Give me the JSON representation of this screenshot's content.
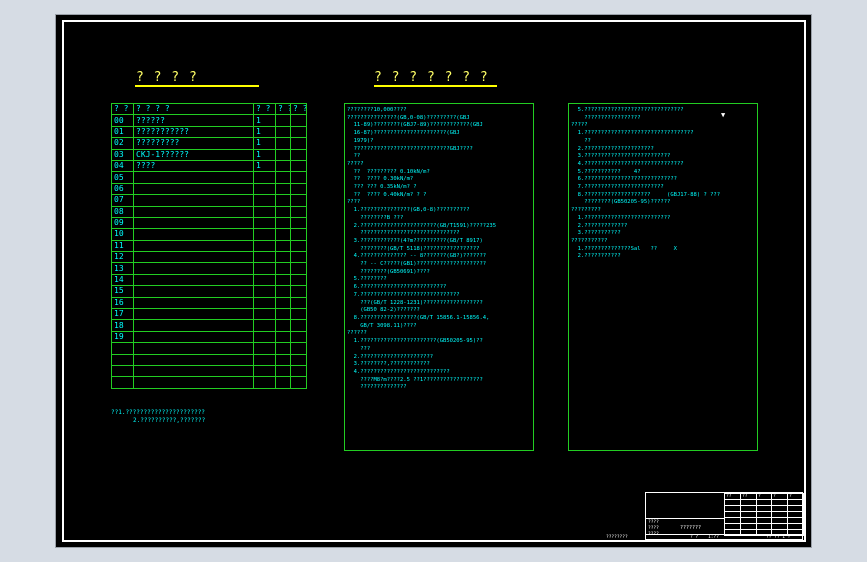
{
  "colors": {
    "background": "#000000",
    "border": "#ffffff",
    "table_lines": "#22cc22",
    "text": "#00ffff",
    "title": "#ffff66"
  },
  "left_title": "? ? ? ?",
  "mid_title": "? ? ? ? ? ? ?",
  "parts_table": {
    "headers": [
      "? ?",
      "? ? ? ?",
      "? ?",
      "? ?",
      "? ?"
    ],
    "rows": [
      {
        "no": "00",
        "name": "??????",
        "qty": "1"
      },
      {
        "no": "01",
        "name": "???????????",
        "qty": "1"
      },
      {
        "no": "02",
        "name": "?????????",
        "qty": "1"
      },
      {
        "no": "03",
        "name": "CKJ-1??????",
        "qty": "1"
      },
      {
        "no": "04",
        "name": "????",
        "qty": "1"
      },
      {
        "no": "05",
        "name": "",
        "qty": ""
      },
      {
        "no": "06",
        "name": "",
        "qty": ""
      },
      {
        "no": "07",
        "name": "",
        "qty": ""
      },
      {
        "no": "08",
        "name": "",
        "qty": ""
      },
      {
        "no": "09",
        "name": "",
        "qty": ""
      },
      {
        "no": "10",
        "name": "",
        "qty": ""
      },
      {
        "no": "11",
        "name": "",
        "qty": ""
      },
      {
        "no": "12",
        "name": "",
        "qty": ""
      },
      {
        "no": "13",
        "name": "",
        "qty": ""
      },
      {
        "no": "14",
        "name": "",
        "qty": ""
      },
      {
        "no": "15",
        "name": "",
        "qty": ""
      },
      {
        "no": "16",
        "name": "",
        "qty": ""
      },
      {
        "no": "17",
        "name": "",
        "qty": ""
      },
      {
        "no": "18",
        "name": "",
        "qty": ""
      },
      {
        "no": "19",
        "name": "",
        "qty": ""
      },
      {
        "no": "",
        "name": "",
        "qty": ""
      },
      {
        "no": "",
        "name": "",
        "qty": ""
      },
      {
        "no": "",
        "name": "",
        "qty": ""
      },
      {
        "no": "",
        "name": "",
        "qty": ""
      }
    ]
  },
  "table_notes": [
    "??1.??????????????????????",
    "2.??????????,???????"
  ],
  "middle_text": [
    "????????10,000????",
    "???????????????(GB,0-08)?????????(GBJ",
    "  11-89)????????(GBJ7-89)????????????(GBJ",
    "  16-87)??????????????????????(GBJ",
    "  1979)?",
    "  ?????????????????????????????GBJ????",
    "  ??",
    "?????",
    "  ??  ????????? 0.10kN/m?",
    "  ??  ???? 0.30kN/m?",
    "  ??? ??? 0.35kN/m? ?",
    "  ??  ???? 0.40kN/m? ? ?",
    "????",
    "  1.???????????????(GB,0-8)??????????",
    "    ????????B ???",
    "  2.???????????????????????(GB/T1591)?????235",
    "    ??????????????????????????????",
    "  3.????????????(4?m??????????(GB/T 8917)",
    "    ????????(GB/T 5118)?????????????????",
    "  4.?????????????? -- 8???????(GB?)???????",
    "    ?? -- C?????(GB1)?????????????????????",
    "    ????????(GB50691)????",
    "  5.????????",
    "  6.??????????????????????????",
    "  7.??????????????????????????????",
    "    ???(GB/T 1228-1231)??????????????????",
    "    (GB50 82-2)???????",
    "  8.?????????????????(GB/T 15856.1-15856.4,",
    "    GB/T 3098.11)????",
    "??????",
    "  1.???????????????????????(GB50205-95)??",
    "    ???",
    "  2.??????????????????????",
    "  3.????????,????????????",
    "  4.???????????????????????????",
    "    ????M8?m????2.5 ??1??????????????????",
    "    ??????????????"
  ],
  "right_text": [
    "  5.??????????????????????????????",
    "    ?????????????????",
    "?????",
    "  1.?????????????????????????????????",
    "    ??",
    "  2.?????????????????????",
    "  3.??????????????????????????",
    "  4.??????????????????????????????",
    "  5.???????????    4?",
    "  6.????????????????????????????",
    "  7.????????????????????????",
    "  8.????????????????????     (GBJ17-88) ? ???",
    "    ????????(GB50205-95)??????",
    "?????????",
    "  1.??????????????????????????",
    "  2.?????????????",
    "  3.???????????",
    "???????????",
    "  1.??????????????Sal   ??     X",
    "  2.???????????"
  ],
  "right_mark": "▼",
  "title_block": {
    "drawing_name": "???????",
    "col_top": [
      "??",
      "??",
      "?",
      "?",
      "?",
      "?"
    ],
    "sig_labels": [
      "????",
      "????",
      "????"
    ],
    "bottom_left": "????????",
    "scale_label": "? ?",
    "scale_value": "1:??",
    "sheet": "?? ?? 1 ?"
  }
}
